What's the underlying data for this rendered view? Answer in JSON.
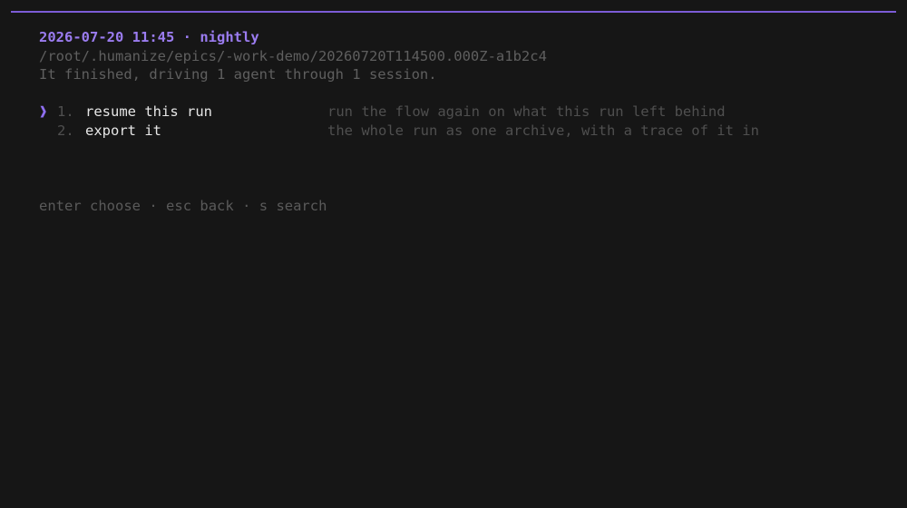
{
  "header": {
    "datetime": "2026-07-20 11:45",
    "separator": "·",
    "run_name": "nightly",
    "path": "/root/.humanize/epics/-work-demo/20260720T114500.000Z-a1b2c4",
    "status_text": "It finished, driving 1 agent through 1 session."
  },
  "menu": {
    "cursor_glyph": "❱",
    "items": [
      {
        "number": "1.",
        "label": "resume this run",
        "description": "run the flow again on what this run left behind",
        "selected": true
      },
      {
        "number": "2.",
        "label": "export it",
        "description": "the whole run as one archive, with a trace of it in",
        "selected": false
      }
    ]
  },
  "footer": {
    "hints": [
      {
        "key": "enter",
        "action": "choose"
      },
      {
        "key": "esc",
        "action": "back"
      },
      {
        "key": "s",
        "action": "search"
      }
    ],
    "separator": "·"
  },
  "colors": {
    "background": "#161616",
    "accent": "#7c5cd6",
    "title": "#9b7cf0",
    "selected_label": "#e6e6e6",
    "dim_text": "#5f5f5f"
  }
}
